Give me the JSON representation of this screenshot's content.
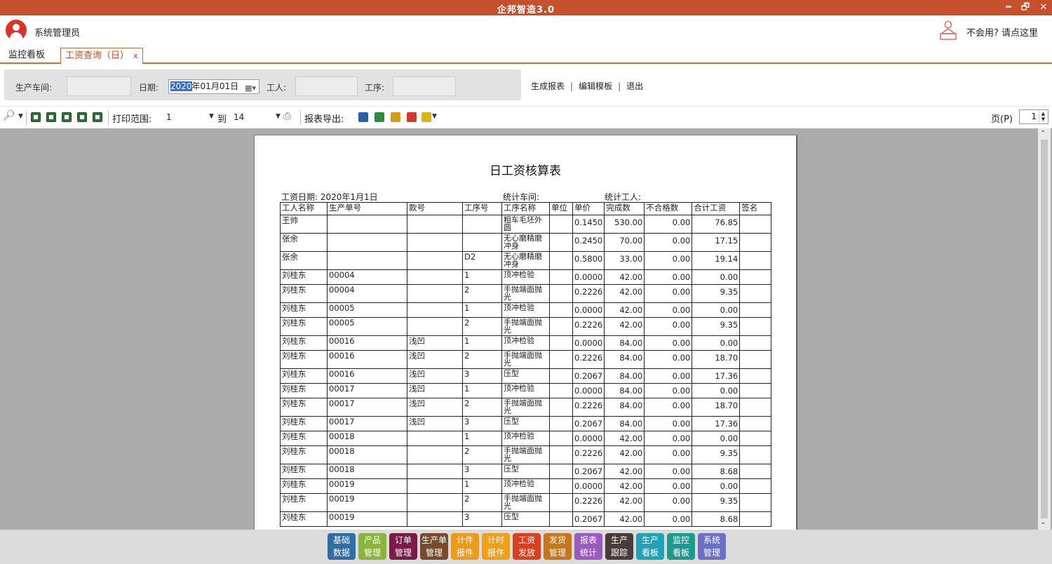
{
  "app": {
    "title": "企邦智造3.0"
  },
  "window": {
    "min": "━",
    "restore": "🗗",
    "close": "✕"
  },
  "user": {
    "name": "系统管理员",
    "help": "不会用? 请点这里"
  },
  "tabs": [
    {
      "label": "监控看板"
    },
    {
      "label": "工资查询（日）",
      "close": "x"
    }
  ],
  "filters": {
    "workshop_label": "生产车间:",
    "date_label": "日期:",
    "date_value_selected": "2020",
    "date_value_rest": "年01月01日",
    "worker_label": "工人:",
    "process_label": "工序:"
  },
  "actions": {
    "generate": "生成报表",
    "edit_template": "编辑模板",
    "exit": "退出"
  },
  "toolbar": {
    "print_range_label": "打印范围:",
    "print_from": "1",
    "to_label": "到",
    "print_to": "14",
    "export_label": "报表导出:",
    "page_label": "页(P)",
    "page_value": "1"
  },
  "report": {
    "title": "日工资核算表",
    "date_label": "工资日期: 2020年1月1日",
    "workshop_label": "统计车间:",
    "worker_label": "统计工人:",
    "columns": [
      "工人名称",
      "生产单号",
      "款号",
      "工序号",
      "工序名称",
      "单位",
      "单价",
      "完成数",
      "不合格数",
      "合计工资",
      "签名"
    ],
    "rows": [
      [
        "王帅",
        "",
        "",
        "",
        "粗车毛坯外圆",
        "",
        "0.1450",
        "530.00",
        "0.00",
        "76.85",
        ""
      ],
      [
        "张余",
        "",
        "",
        "",
        "无心磨精磨冲身",
        "",
        "0.2450",
        "70.00",
        "0.00",
        "17.15",
        ""
      ],
      [
        "张余",
        "",
        "",
        "D2",
        "无心磨精磨冲身",
        "",
        "0.5800",
        "33.00",
        "0.00",
        "19.14",
        ""
      ],
      [
        "刘桂东",
        "00004",
        "",
        "1",
        "顶冲检验",
        "",
        "0.0000",
        "42.00",
        "0.00",
        "0.00",
        ""
      ],
      [
        "刘桂东",
        "00004",
        "",
        "2",
        "手抛端面抛光",
        "",
        "0.2226",
        "42.00",
        "0.00",
        "9.35",
        ""
      ],
      [
        "刘桂东",
        "00005",
        "",
        "1",
        "顶冲检验",
        "",
        "0.0000",
        "42.00",
        "0.00",
        "0.00",
        ""
      ],
      [
        "刘桂东",
        "00005",
        "",
        "2",
        "手抛端面抛光",
        "",
        "0.2226",
        "42.00",
        "0.00",
        "9.35",
        ""
      ],
      [
        "刘桂东",
        "00016",
        "浅凹",
        "1",
        "顶冲检验",
        "",
        "0.0000",
        "84.00",
        "0.00",
        "0.00",
        ""
      ],
      [
        "刘桂东",
        "00016",
        "浅凹",
        "2",
        "手抛端面抛光",
        "",
        "0.2226",
        "84.00",
        "0.00",
        "18.70",
        ""
      ],
      [
        "刘桂东",
        "00016",
        "浅凹",
        "3",
        "压型",
        "",
        "0.2067",
        "84.00",
        "0.00",
        "17.36",
        ""
      ],
      [
        "刘桂东",
        "00017",
        "浅凹",
        "1",
        "顶冲检验",
        "",
        "0.0000",
        "84.00",
        "0.00",
        "0.00",
        ""
      ],
      [
        "刘桂东",
        "00017",
        "浅凹",
        "2",
        "手抛端面抛光",
        "",
        "0.2226",
        "84.00",
        "0.00",
        "18.70",
        ""
      ],
      [
        "刘桂东",
        "00017",
        "浅凹",
        "3",
        "压型",
        "",
        "0.2067",
        "84.00",
        "0.00",
        "17.36",
        ""
      ],
      [
        "刘桂东",
        "00018",
        "",
        "1",
        "顶冲检验",
        "",
        "0.0000",
        "42.00",
        "0.00",
        "0.00",
        ""
      ],
      [
        "刘桂东",
        "00018",
        "",
        "2",
        "手抛端面抛光",
        "",
        "0.2226",
        "42.00",
        "0.00",
        "9.35",
        ""
      ],
      [
        "刘桂东",
        "00018",
        "",
        "3",
        "压型",
        "",
        "0.2067",
        "42.00",
        "0.00",
        "8.68",
        ""
      ],
      [
        "刘桂东",
        "00019",
        "",
        "1",
        "顶冲检验",
        "",
        "0.0000",
        "42.00",
        "0.00",
        "0.00",
        ""
      ],
      [
        "刘桂东",
        "00019",
        "",
        "2",
        "手抛端面抛光",
        "",
        "0.2226",
        "42.00",
        "0.00",
        "9.35",
        ""
      ],
      [
        "刘桂东",
        "00019",
        "",
        "3",
        "压型",
        "",
        "0.2067",
        "42.00",
        "0.00",
        "8.68",
        ""
      ]
    ]
  },
  "modules": [
    {
      "line1": "基础",
      "line2": "数据",
      "color": "#2d6ea8"
    },
    {
      "line1": "产品",
      "line2": "管理",
      "color": "#8bb53a"
    },
    {
      "line1": "订单",
      "line2": "管理",
      "color": "#7d1a48"
    },
    {
      "line1": "生产单",
      "line2": "管理",
      "color": "#7a4b2a"
    },
    {
      "line1": "计件",
      "line2": "报件",
      "color": "#f09a1a"
    },
    {
      "line1": "计时",
      "line2": "报件",
      "color": "#f0a018"
    },
    {
      "line1": "工资",
      "line2": "发放",
      "color": "#d9401e"
    },
    {
      "line1": "发货",
      "line2": "管理",
      "color": "#c9761a"
    },
    {
      "line1": "报表",
      "line2": "统计",
      "color": "#9a5bc0"
    },
    {
      "line1": "生产",
      "line2": "跟踪",
      "color": "#4a3b3b"
    },
    {
      "line1": "生产",
      "line2": "看板",
      "color": "#1fa3b8"
    },
    {
      "line1": "监控",
      "line2": "看板",
      "color": "#1b9a8f"
    },
    {
      "line1": "系统",
      "line2": "管理",
      "color": "#6a6fc8"
    }
  ]
}
